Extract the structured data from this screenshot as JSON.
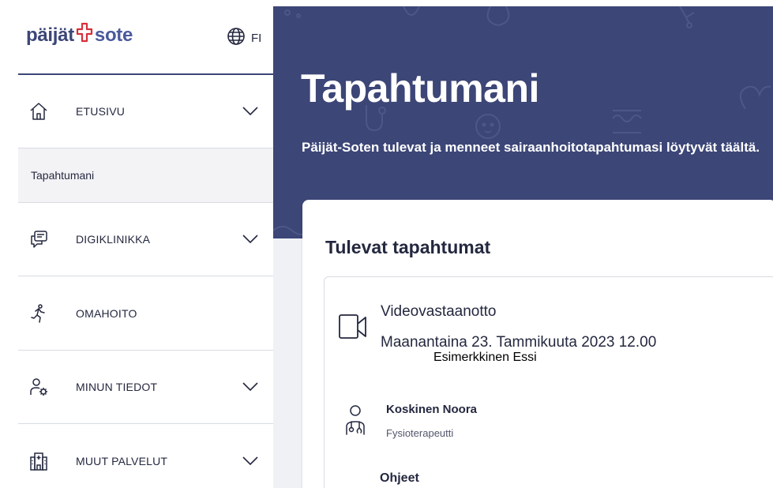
{
  "brand": {
    "logo_part1": "päijät",
    "logo_part2": "sote"
  },
  "language": {
    "code": "FI",
    "icon": "globe-icon"
  },
  "sidebar": {
    "items": [
      {
        "label": "ETUSIVU",
        "icon": "home-icon",
        "expandable": true
      },
      {
        "label": "Tapahtumani",
        "sub": true,
        "selected": true
      },
      {
        "label": "DIGIKLINIKKA",
        "icon": "chat-icon",
        "expandable": true
      },
      {
        "label": "OMAHOITO",
        "icon": "running-person-icon",
        "expandable": false
      },
      {
        "label": "MINUN TIEDOT",
        "icon": "user-settings-icon",
        "expandable": true
      },
      {
        "label": "MUUT PALVELUT",
        "icon": "hospital-icon",
        "expandable": true
      }
    ]
  },
  "main": {
    "title": "Tapahtumani",
    "subtitle": "Päijät-Soten tulevat ja menneet sairaanhoitotapahtumasi löytyvät täältä.",
    "section_title": "Tulevat tapahtumat",
    "event": {
      "type": "Videovastaanotto",
      "datetime": "Maanantaina 23. Tammikuuta 2023 12.00",
      "patient": "Esimerkkinen Essi",
      "professional_name": "Koskinen Noora",
      "professional_role": "Fysioterapeutti",
      "instructions_label": "Ohjeet"
    }
  },
  "colors": {
    "brand_navy": "#3c4677",
    "accent_red": "#d7303a",
    "page_bg": "#f0f1f5"
  }
}
